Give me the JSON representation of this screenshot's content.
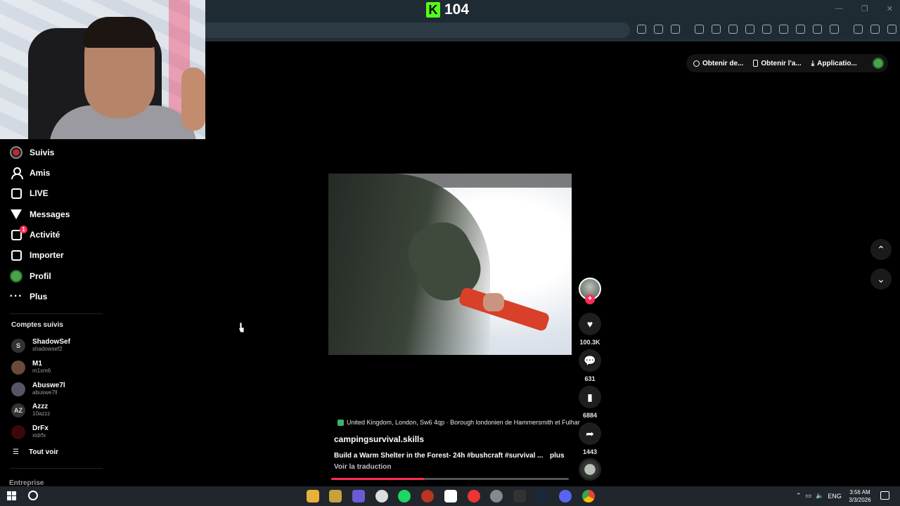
{
  "kick": {
    "viewer_count": "104"
  },
  "top_pill": {
    "items": [
      "Obtenir de...",
      "Obtenir l'a...",
      "Applicatio..."
    ]
  },
  "sidebar": {
    "nav": [
      {
        "label": "Suivis",
        "icon": "following-icon"
      },
      {
        "label": "Amis",
        "icon": "friends-icon"
      },
      {
        "label": "LIVE",
        "icon": "live-icon"
      },
      {
        "label": "Messages",
        "icon": "messages-icon"
      },
      {
        "label": "Activité",
        "icon": "activity-icon",
        "badge": "1"
      },
      {
        "label": "Importer",
        "icon": "upload-icon"
      },
      {
        "label": "Profil",
        "icon": "profile-icon"
      },
      {
        "label": "Plus",
        "icon": "more-icon"
      }
    ],
    "followed_title": "Comptes suivis",
    "followed": [
      {
        "name": "ShadowSef",
        "handle": "shadowsef2",
        "initial": "S"
      },
      {
        "name": "M1",
        "handle": "m1xm6",
        "initial": ""
      },
      {
        "name": "Abuswe7l",
        "handle": "abuswe7ll",
        "initial": ""
      },
      {
        "name": "Azzz",
        "handle": "10azzz",
        "initial": "AZ"
      },
      {
        "name": "DrFx",
        "handle": "xidrfx",
        "initial": ""
      }
    ],
    "see_all": "Tout voir",
    "footer": "Entreprise"
  },
  "video": {
    "location": "United Kingdom, London, Sw6 4qp · Borough londonien de Hammersmith et Fulhar",
    "username": "campingsurvival.skills",
    "description": "Build a Warm Shelter in the Forest- 24h #bushcraft #survival ...",
    "more_label": "plus",
    "translate_label": "Voir la traduction",
    "progress": 0.39
  },
  "actions": {
    "likes": "100.3K",
    "comments": "631",
    "saves": "6884",
    "shares": "1443"
  },
  "taskbar": {
    "language": "ENG",
    "time": "3:56 AM",
    "date": "3/3/2026"
  }
}
